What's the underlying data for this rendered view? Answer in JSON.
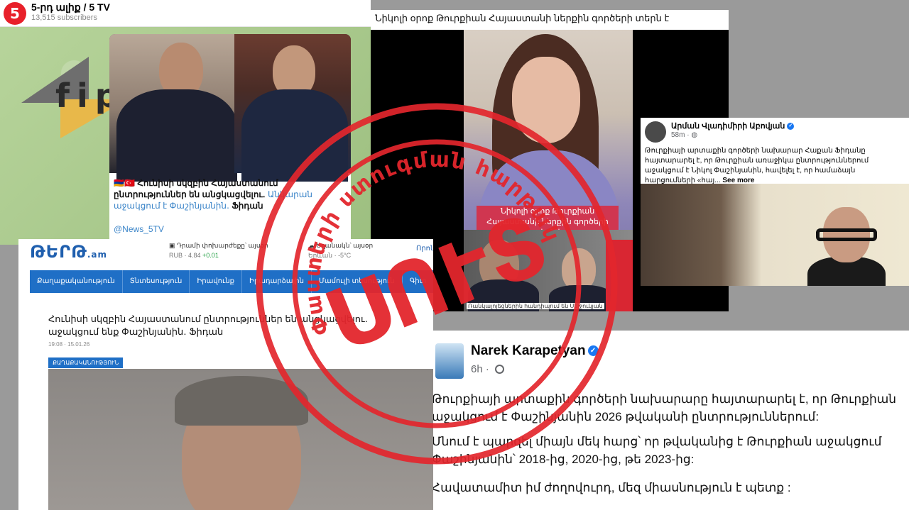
{
  "telegram": {
    "avatar_glyph": "5",
    "channel_name": "5-րդ ալիք / 5 TV",
    "subscribers": "13,515 subscribers",
    "logo_text": "fip",
    "caption_main": "Հունիսի սկզբին Հայաստանում ընտրություններ են անցկացվելու․",
    "caption_link": "Անկարան աջակցում է Փաշինյանին․",
    "caption_end": "Ֆիդան",
    "handle": "@News_5TV"
  },
  "video": {
    "title": "Նիկոլի օրոք Թուրքիան Հայաստանի ներքին գործերի տերն է",
    "subtitle": "Նիկոլի օրոք Թուրքիան Հայաստանի ներքին գործերի տերն է",
    "inset_caption": "Ռանկալոյեցներին հանդիպում են Սելջուկյան"
  },
  "fb_post_1": {
    "author": "Արման Վլադիմիրի Աբովյան",
    "time": "58m",
    "text": "Թուրքիայի արտաքին գործերի նախարար Հաքան Ֆիդանը հայտարարել է, որ Թուրքիան առաջիկա ընտրություններում աջակցում է Նիկոլ Փաշինյանին, հավելել է, որ համաձայն հարցումների «հայ...",
    "see_more": "See more"
  },
  "tert": {
    "logo": "ԹԵՐԹ",
    "logo_suffix": ".am",
    "rate_label": "Դրամի փոխարժեքը՝ այսօր",
    "rate_value": "RUB · 4.84",
    "rate_change": "+0.01",
    "weather_label": "Եղանակն՝ այսօր",
    "weather_value": "Երևան · -5°C",
    "more": "Որոն",
    "nav": [
      "Քաղաքականություն",
      "Տնտեսություն",
      "Իրավունք",
      "Իրադարձային",
      "Մամուլի տեսություն",
      "Գիտ"
    ],
    "headline": "Հունիսի սկզբին Հայաստանում ընտրություններ են անցկացվելու․ աջակցում ենք Փաշինյանին․ Ֆիդան",
    "date": "19:08 · 15.01.26",
    "tag": "ՔԱՂԱՔԱԿԱՆՈՒԹՅՈՒՆ"
  },
  "fb_post_2": {
    "author": "Narek Karapetyan",
    "time": "6h",
    "para1": "Թուրքիայի արտաքին գործերի նախարարը հայտարարել է, որ Թուրքիան աջակցում է Փաշինյանին 2026 թվականի ընտրություններում:",
    "para2": "Մնում է պարզել միայն մեկ հարց՝ որ թվականից է Թուրքիան աջակցում Փաշինյանին՝ 2018-ից, 2020-ից, թե 2023-ից:",
    "para3": "Հավատամիտ իմ ժողովուրդ, մեզ միասնություն է պետք :"
  },
  "stamp": {
    "arc_text": "Փաստերի ստուգման հարթակ",
    "center_text": "ՍՈՒՏ",
    "color": "#e3262d"
  }
}
